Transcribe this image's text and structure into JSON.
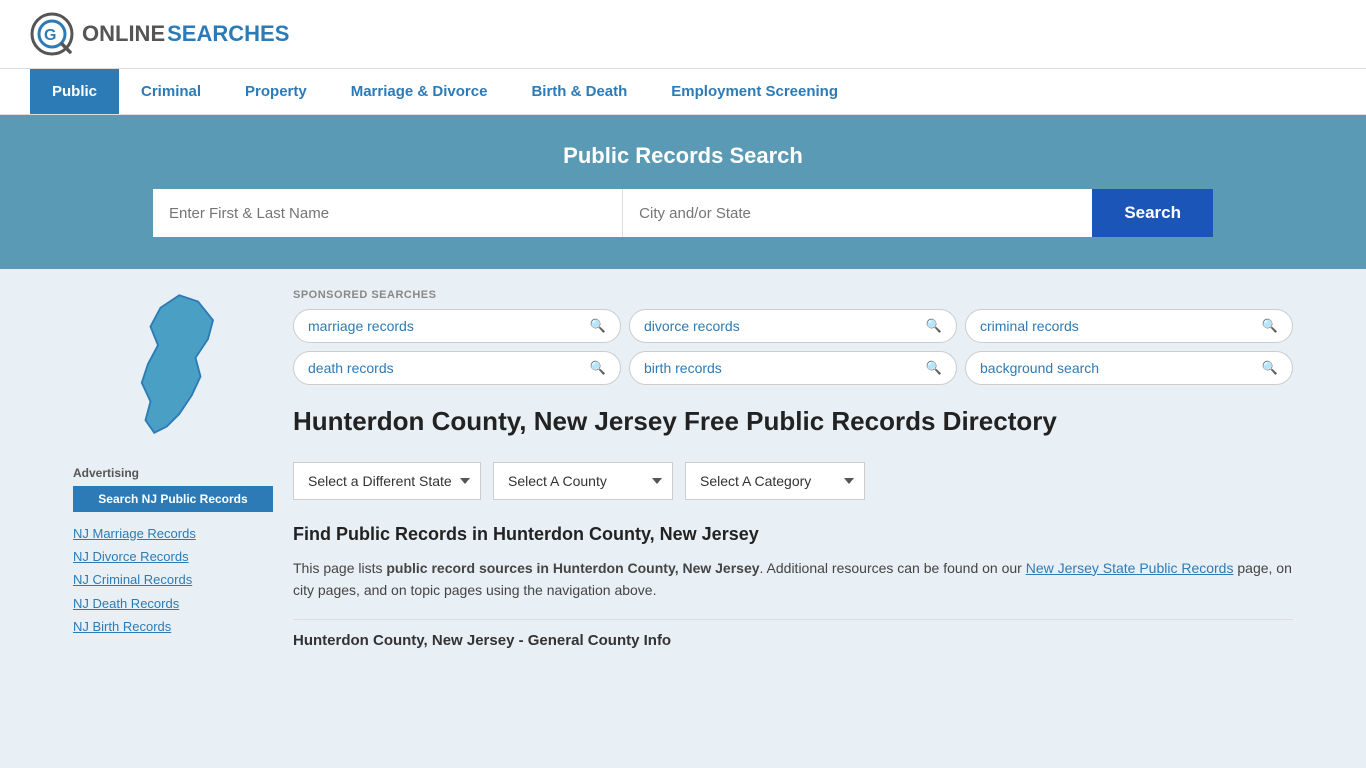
{
  "logo": {
    "online": "ONLINE",
    "searches": "SEARCHES"
  },
  "nav": {
    "items": [
      {
        "label": "Public",
        "active": true
      },
      {
        "label": "Criminal",
        "active": false
      },
      {
        "label": "Property",
        "active": false
      },
      {
        "label": "Marriage & Divorce",
        "active": false
      },
      {
        "label": "Birth & Death",
        "active": false
      },
      {
        "label": "Employment Screening",
        "active": false
      }
    ]
  },
  "hero": {
    "title": "Public Records Search",
    "name_placeholder": "Enter First & Last Name",
    "location_placeholder": "City and/or State",
    "search_button": "Search"
  },
  "sponsored": {
    "label": "SPONSORED SEARCHES",
    "items": [
      "marriage records",
      "divorce records",
      "criminal records",
      "death records",
      "birth records",
      "background search"
    ]
  },
  "page": {
    "title": "Hunterdon County, New Jersey Free Public Records Directory",
    "dropdowns": {
      "state_label": "Select a Different State",
      "county_label": "Select A County",
      "category_label": "Select A Category"
    },
    "find_heading": "Find Public Records in Hunterdon County, New Jersey",
    "find_text_before": "This page lists ",
    "find_text_bold": "public record sources in Hunterdon County, New Jersey",
    "find_text_after": ". Additional resources can be found on our ",
    "find_link": "New Jersey State Public Records",
    "find_text_end": " page, on city pages, and on topic pages using the navigation above.",
    "section_bottom_heading": "Hunterdon County, New Jersey - General County Info"
  },
  "sidebar": {
    "advertising_label": "Advertising",
    "ad_button": "Search NJ Public Records",
    "links": [
      "NJ Marriage Records",
      "NJ Divorce Records",
      "NJ Criminal Records",
      "NJ Death Records",
      "NJ Birth Records"
    ]
  }
}
